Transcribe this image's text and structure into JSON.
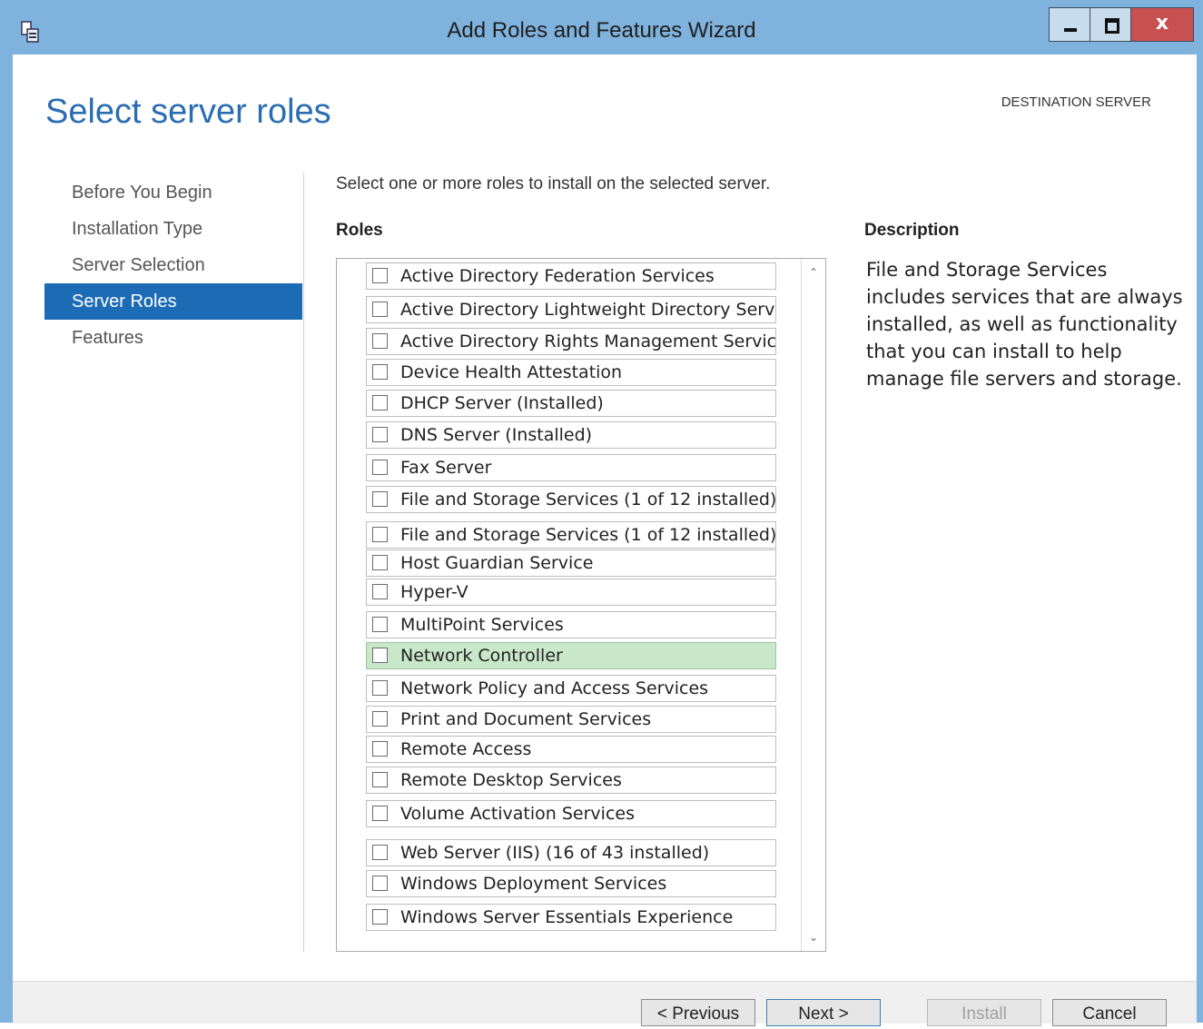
{
  "window": {
    "title": "Add Roles and Features Wizard",
    "close_glyph": "x"
  },
  "page": {
    "heading": "Select server roles",
    "destination_label": "DESTINATION SERVER"
  },
  "nav": {
    "items": [
      {
        "label": "Before You Begin",
        "active": false
      },
      {
        "label": "Installation Type",
        "active": false
      },
      {
        "label": "Server Selection",
        "active": false
      },
      {
        "label": "Server Roles",
        "active": true
      },
      {
        "label": "Features",
        "active": false
      }
    ]
  },
  "main": {
    "instruction": "Select one or more roles to install on the selected server.",
    "roles_label": "Roles",
    "roles": [
      {
        "label": "Active Directory Federation Services",
        "checked": false
      },
      {
        "label": "Active Directory Lightweight Directory Services",
        "checked": false
      },
      {
        "label": "Active Directory Rights Management Services",
        "checked": false
      },
      {
        "label": "Device Health Attestation",
        "checked": false
      },
      {
        "label": "DHCP Server (Installed)",
        "checked": false
      },
      {
        "label": "DNS Server (Installed)",
        "checked": false
      },
      {
        "label": "Fax Server",
        "checked": false
      },
      {
        "label": "File and Storage Services (1 of 12 installed)",
        "checked": false
      },
      {
        "label": "File and Storage Services (1 of 12 installed)",
        "checked": false
      },
      {
        "label": "Host Guardian Service",
        "checked": false
      },
      {
        "label": "Hyper-V",
        "checked": false
      },
      {
        "label": "MultiPoint Services",
        "checked": false
      },
      {
        "label": "Network Controller",
        "checked": false,
        "highlighted": true
      },
      {
        "label": "Network Policy and Access Services",
        "checked": false
      },
      {
        "label": "Print and Document Services",
        "checked": false
      },
      {
        "label": "Remote Access",
        "checked": false
      },
      {
        "label": "Remote Desktop Services",
        "checked": false
      },
      {
        "label": "Volume Activation Services",
        "checked": false
      },
      {
        "label": "Web Server (IIS) (16 of 43 installed)",
        "checked": false
      },
      {
        "label": "Windows Deployment Services",
        "checked": false
      },
      {
        "label": "Windows Server Essentials Experience",
        "checked": false
      }
    ]
  },
  "description": {
    "label": "Description",
    "text": "File and Storage Services includes services that are always installed, as well as functionality that you can install to help manage file servers and storage."
  },
  "footer": {
    "previous": "< Previous",
    "next": "Next >",
    "install": "Install",
    "cancel": "Cancel"
  },
  "colors": {
    "accent": "#1c6bb5",
    "heading": "#2a6db0",
    "highlight_row": "#c9e8c9",
    "titlebar": "#7fb2dc"
  }
}
